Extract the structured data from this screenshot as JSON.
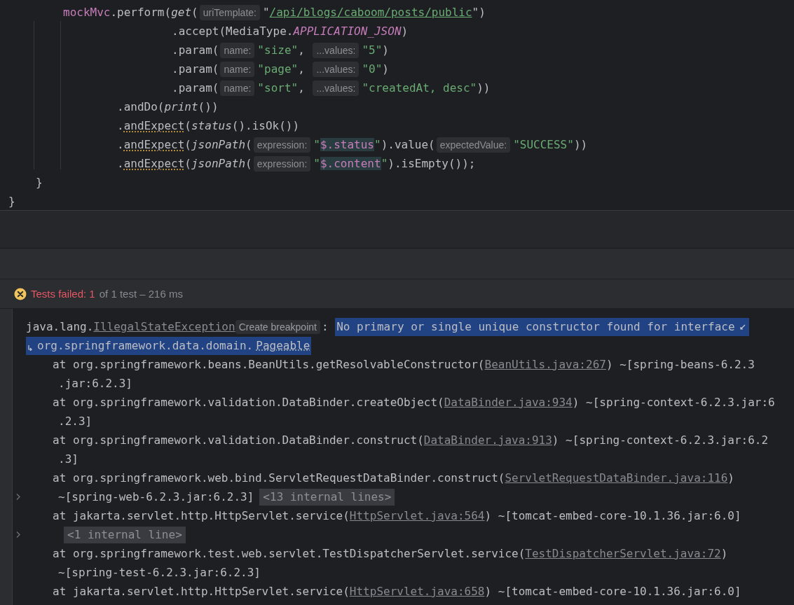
{
  "editor": {
    "lines": [
      {
        "kind": "call",
        "tokens": [
          {
            "kind": "field",
            "text": "mockMvc"
          },
          {
            "kind": "plain",
            "text": ".perform("
          },
          {
            "kind": "italic",
            "text": "get"
          },
          {
            "kind": "plain",
            "text": "("
          },
          {
            "kind": "hint",
            "text": "uriTemplate:"
          },
          {
            "kind": "plain",
            "text": "\""
          },
          {
            "kind": "url",
            "text": "/api/blogs/caboom/posts/public"
          },
          {
            "kind": "plain",
            "text": "\")"
          }
        ]
      },
      {
        "kind": "arg",
        "tokens": [
          {
            "kind": "plain",
            "text": ".accept(MediaType."
          },
          {
            "kind": "constant",
            "text": "APPLICATION_JSON"
          },
          {
            "kind": "plain",
            "text": ")"
          }
        ]
      },
      {
        "kind": "arg",
        "tokens": [
          {
            "kind": "plain",
            "text": ".param("
          },
          {
            "kind": "hint",
            "text": "name:"
          },
          {
            "kind": "string",
            "text": "\"size\""
          },
          {
            "kind": "plain",
            "text": ", "
          },
          {
            "kind": "hint",
            "text": "...values:"
          },
          {
            "kind": "string",
            "text": "\"5\""
          },
          {
            "kind": "plain",
            "text": ")"
          }
        ]
      },
      {
        "kind": "arg",
        "tokens": [
          {
            "kind": "plain",
            "text": ".param("
          },
          {
            "kind": "hint",
            "text": "name:"
          },
          {
            "kind": "string",
            "text": "\"page\""
          },
          {
            "kind": "plain",
            "text": ", "
          },
          {
            "kind": "hint",
            "text": "...values:"
          },
          {
            "kind": "string",
            "text": "\"0\""
          },
          {
            "kind": "plain",
            "text": ")"
          }
        ]
      },
      {
        "kind": "arg",
        "tokens": [
          {
            "kind": "plain",
            "text": ".param("
          },
          {
            "kind": "hint",
            "text": "name:"
          },
          {
            "kind": "string",
            "text": "\"sort\""
          },
          {
            "kind": "plain",
            "text": ", "
          },
          {
            "kind": "hint",
            "text": "...values:"
          },
          {
            "kind": "string",
            "text": "\"createdAt, desc\""
          },
          {
            "kind": "plain",
            "text": "))"
          }
        ]
      },
      {
        "kind": "chain",
        "tokens": [
          {
            "kind": "plain",
            "text": ".andDo("
          },
          {
            "kind": "italic",
            "text": "print"
          },
          {
            "kind": "plain",
            "text": "())"
          }
        ]
      },
      {
        "kind": "chain",
        "tokens": [
          {
            "kind": "plain",
            "text": "."
          },
          {
            "kind": "warn",
            "text": "andExpect"
          },
          {
            "kind": "plain",
            "text": "("
          },
          {
            "kind": "italic",
            "text": "status"
          },
          {
            "kind": "plain",
            "text": "().isOk())"
          }
        ]
      },
      {
        "kind": "chain",
        "tokens": [
          {
            "kind": "plain",
            "text": "."
          },
          {
            "kind": "warn",
            "text": "andExpect"
          },
          {
            "kind": "plain",
            "text": "("
          },
          {
            "kind": "italic",
            "text": "jsonPath"
          },
          {
            "kind": "plain",
            "text": "("
          },
          {
            "kind": "hint",
            "text": "expression:"
          },
          {
            "kind": "string",
            "text": "\""
          },
          {
            "kind": "jsonpath",
            "text": "$.status"
          },
          {
            "kind": "string",
            "text": "\""
          },
          {
            "kind": "plain",
            "text": ").value("
          },
          {
            "kind": "hint",
            "text": "expectedValue:"
          },
          {
            "kind": "string",
            "text": "\"SUCCESS\""
          },
          {
            "kind": "plain",
            "text": "))"
          }
        ]
      },
      {
        "kind": "chain",
        "tokens": [
          {
            "kind": "plain",
            "text": "."
          },
          {
            "kind": "warn",
            "text": "andExpect"
          },
          {
            "kind": "plain",
            "text": "("
          },
          {
            "kind": "italic",
            "text": "jsonPath"
          },
          {
            "kind": "plain",
            "text": "("
          },
          {
            "kind": "hint",
            "text": "expression:"
          },
          {
            "kind": "string",
            "text": "\""
          },
          {
            "kind": "jsonpath",
            "text": "$.content"
          },
          {
            "kind": "string",
            "text": "\""
          },
          {
            "kind": "plain",
            "text": ").isEmpty());"
          }
        ]
      },
      {
        "kind": "close-method",
        "tokens": [
          {
            "kind": "plain",
            "text": "}"
          }
        ]
      },
      {
        "kind": "close-class",
        "tokens": [
          {
            "kind": "plain",
            "text": "}"
          }
        ]
      }
    ]
  },
  "test_run": {
    "failed_label": "Tests failed: 1",
    "summary": "of 1 test – 216 ms"
  },
  "console": {
    "lines": [
      {
        "kind": "exception",
        "foldable": false,
        "tokens": [
          {
            "kind": "plain",
            "text": "java.lang."
          },
          {
            "kind": "link",
            "text": "IllegalStateException"
          },
          {
            "kind": "hint",
            "text": "Create breakpoint"
          },
          {
            "kind": "plain",
            "text": ": "
          },
          {
            "kind": "selected",
            "text": "No primary or single unique constructor found for interface"
          },
          {
            "kind": "softwrap-end"
          }
        ]
      },
      {
        "kind": "exception",
        "foldable": false,
        "tokens": [
          {
            "kind": "softwrap-start"
          },
          {
            "kind": "selected",
            "text": "org.springframework.data.domain."
          },
          {
            "kind": "selected-dotted",
            "text": "Pageable"
          }
        ]
      },
      {
        "kind": "frame",
        "foldable": false,
        "tokens": [
          {
            "kind": "plain",
            "text": "at org.springframework.beans.BeanUtils.getResolvableConstructor("
          },
          {
            "kind": "link",
            "text": "BeanUtils.java:267"
          },
          {
            "kind": "plain",
            "text": ") ~[spring-beans-6.2.3"
          }
        ]
      },
      {
        "kind": "wrap",
        "foldable": false,
        "tokens": [
          {
            "kind": "plain",
            "text": ".jar:6.2.3]"
          }
        ]
      },
      {
        "kind": "frame",
        "foldable": false,
        "tokens": [
          {
            "kind": "plain",
            "text": "at org.springframework.validation.DataBinder.createObject("
          },
          {
            "kind": "link",
            "text": "DataBinder.java:934"
          },
          {
            "kind": "plain",
            "text": ") ~[spring-context-6.2.3.jar:6"
          }
        ]
      },
      {
        "kind": "wrap",
        "foldable": false,
        "tokens": [
          {
            "kind": "plain",
            "text": ".2.3]"
          }
        ]
      },
      {
        "kind": "frame",
        "foldable": false,
        "tokens": [
          {
            "kind": "plain",
            "text": "at org.springframework.validation.DataBinder.construct("
          },
          {
            "kind": "link",
            "text": "DataBinder.java:913"
          },
          {
            "kind": "plain",
            "text": ") ~[spring-context-6.2.3.jar:6.2"
          }
        ]
      },
      {
        "kind": "wrap",
        "foldable": false,
        "tokens": [
          {
            "kind": "plain",
            "text": ".3]"
          }
        ]
      },
      {
        "kind": "frame",
        "foldable": false,
        "tokens": [
          {
            "kind": "plain",
            "text": "at org.springframework.web.bind.ServletRequestDataBinder.construct("
          },
          {
            "kind": "link",
            "text": "ServletRequestDataBinder.java:116"
          },
          {
            "kind": "plain",
            "text": ")"
          }
        ]
      },
      {
        "kind": "wrap",
        "foldable": true,
        "tokens": [
          {
            "kind": "plain",
            "text": "~[spring-web-6.2.3.jar:6.2.3]"
          },
          {
            "kind": "fold",
            "text": "<13 internal lines>"
          }
        ]
      },
      {
        "kind": "frame",
        "foldable": false,
        "tokens": [
          {
            "kind": "plain",
            "text": "at jakarta.servlet.http.HttpServlet.service("
          },
          {
            "kind": "link",
            "text": "HttpServlet.java:564"
          },
          {
            "kind": "plain",
            "text": ") ~[tomcat-embed-core-10.1.36.jar:6.0]"
          }
        ]
      },
      {
        "kind": "wrap",
        "foldable": true,
        "tokens": [
          {
            "kind": "fold",
            "text": "<1 internal line>"
          }
        ]
      },
      {
        "kind": "frame",
        "foldable": false,
        "tokens": [
          {
            "kind": "plain",
            "text": "at org.springframework.test.web.servlet.TestDispatcherServlet.service("
          },
          {
            "kind": "link",
            "text": "TestDispatcherServlet.java:72"
          },
          {
            "kind": "plain",
            "text": ")"
          }
        ]
      },
      {
        "kind": "wrap",
        "foldable": false,
        "tokens": [
          {
            "kind": "plain",
            "text": "~[spring-test-6.2.3.jar:6.2.3]"
          }
        ]
      },
      {
        "kind": "frame",
        "foldable": false,
        "tokens": [
          {
            "kind": "plain",
            "text": "at jakarta.servlet.http.HttpServlet.service("
          },
          {
            "kind": "link",
            "text": "HttpServlet.java:658"
          },
          {
            "kind": "plain",
            "text": ") ~[tomcat-embed-core-10.1.36.jar:6.0]"
          }
        ]
      }
    ]
  }
}
